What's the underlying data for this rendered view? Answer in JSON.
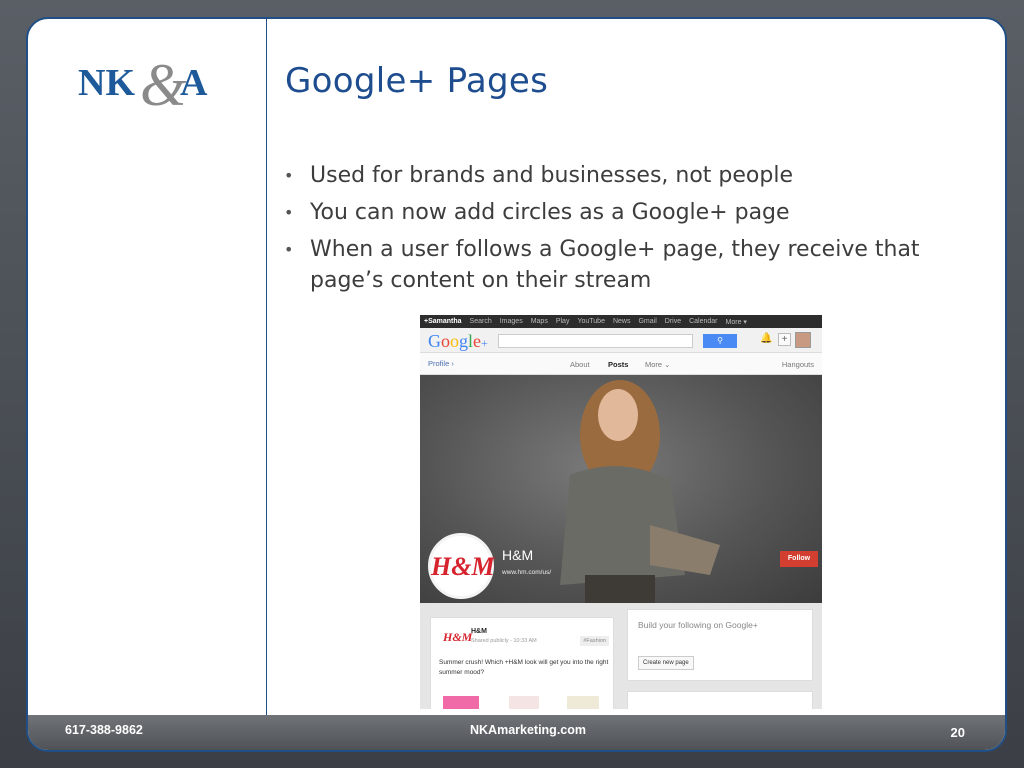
{
  "slide": {
    "title": "Google+ Pages",
    "bullets": [
      "Used for brands and businesses, not people",
      "You can now add circles as a Google+ page",
      "When a user follows a Google+ page, they receive that page’s content on their stream"
    ],
    "logo_text": "NK&A",
    "colors": {
      "brand_blue": "#1e4d8f",
      "frame_blue": "#1f4f86",
      "footer_gray": "#5f6368"
    }
  },
  "footer": {
    "phone": "617-388-9862",
    "website": "NKAmarketing.com",
    "page_number": "20"
  },
  "screenshot": {
    "topbar": [
      "+Samantha",
      "Search",
      "Images",
      "Maps",
      "Play",
      "YouTube",
      "News",
      "Gmail",
      "Drive",
      "Calendar",
      "More ▾"
    ],
    "logo": "Google+",
    "nav": {
      "profile": "Profile ›",
      "about": "About",
      "posts": "Posts",
      "more": "More ⌄",
      "hangouts": "Hangouts"
    },
    "page_name": "H&M",
    "page_url": "www.hm.com/us/",
    "follow_label": "Follow",
    "post": {
      "author": "H&M",
      "meta": "Shared publicly - 10:33 AM",
      "tag": "#Fashion",
      "text": "Summer crush! Which +H&M look will get you into the right summer mood?"
    },
    "build": {
      "text": "Build your following on Google+",
      "button": "Create new page"
    }
  }
}
